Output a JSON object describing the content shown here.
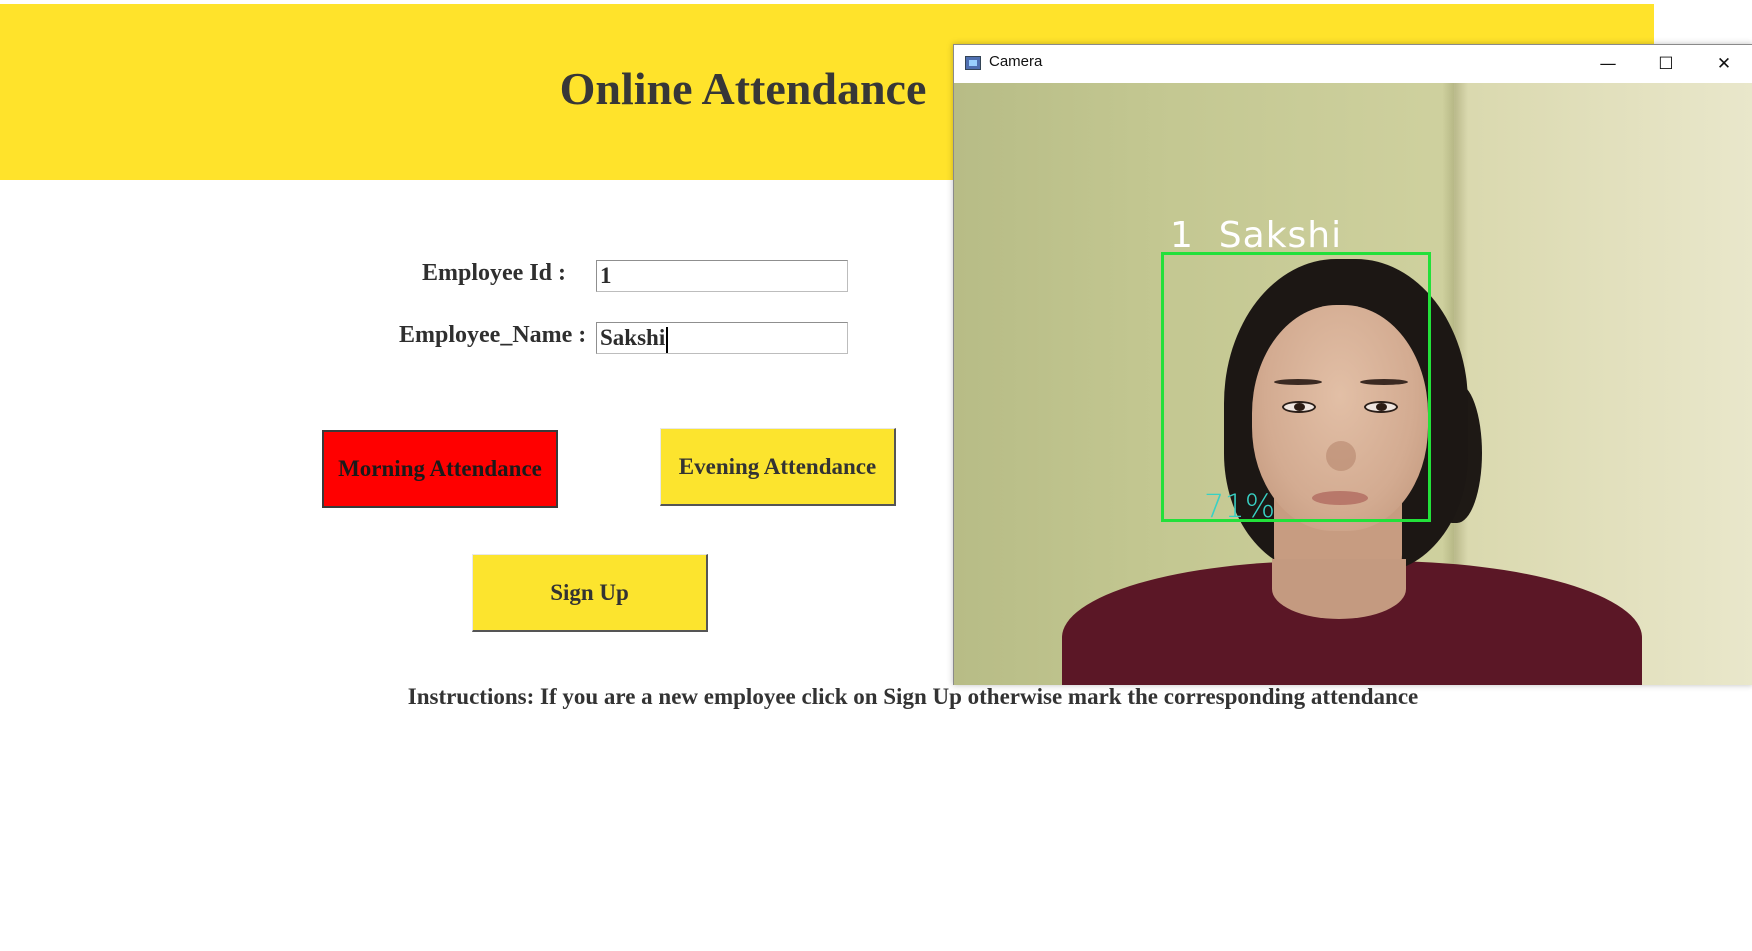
{
  "header": {
    "title": "Online Attendance"
  },
  "form": {
    "employee_id_label": "Employee Id :",
    "employee_id_value": "1",
    "employee_name_label": "Employee_Name :",
    "employee_name_value": "Sakshi"
  },
  "buttons": {
    "morning": "Morning Attendance",
    "evening": "Evening Attendance",
    "signup": "Sign Up"
  },
  "instructions": "Instructions: If you are a new employee click on Sign Up otherwise mark the corresponding attendance",
  "camera": {
    "window_title": "Camera",
    "minimize_glyph": "—",
    "maximize_glyph": "☐",
    "close_glyph": "✕",
    "detection_label": "1  Sakshi",
    "confidence": "71%"
  },
  "colors": {
    "banner": "#ffe32b",
    "button_yellow": "#fce42e",
    "button_active_red": "#ff0000",
    "face_box": "#22e03a",
    "confidence_text": "#38d1c4"
  }
}
